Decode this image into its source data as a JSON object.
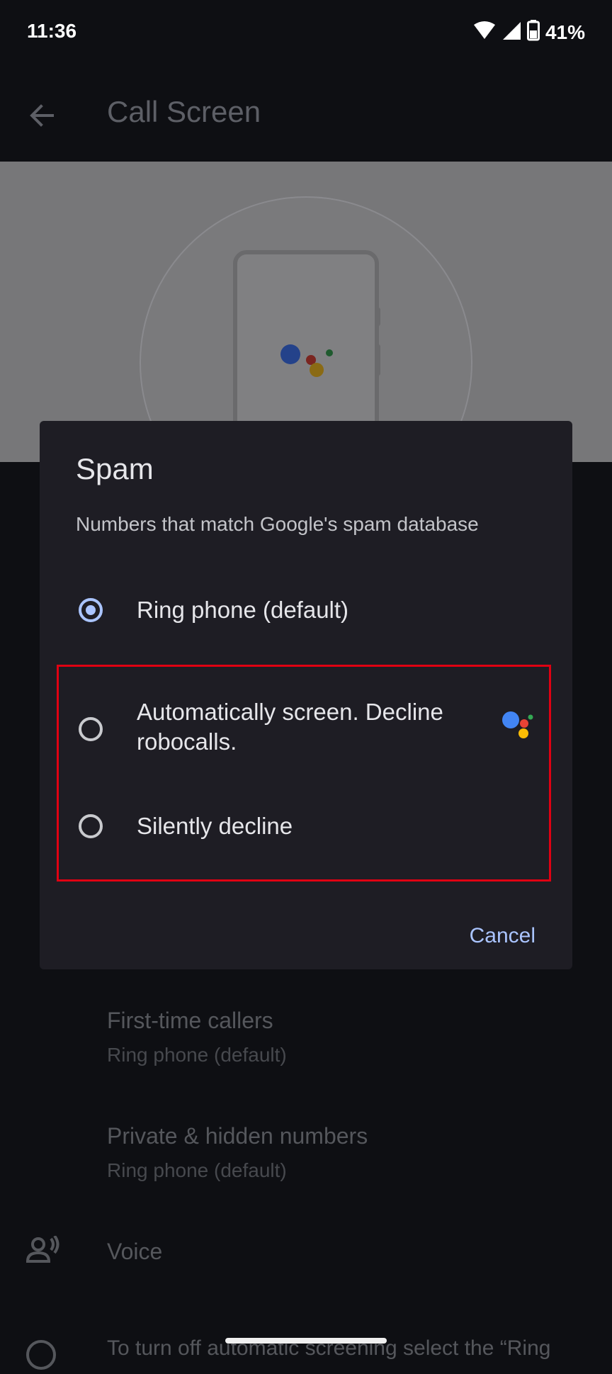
{
  "status_bar": {
    "time": "11:36",
    "battery": "41%"
  },
  "app_bar": {
    "title": "Call Screen"
  },
  "settings": {
    "first_time_callers": {
      "title": "First-time callers",
      "value": "Ring phone (default)"
    },
    "private_numbers": {
      "title": "Private & hidden numbers",
      "value": "Ring phone (default)"
    },
    "voice": {
      "label": "Voice"
    },
    "info_text": "To turn off automatic screening select the “Ring"
  },
  "dialog": {
    "title": "Spam",
    "subtitle": "Numbers that match Google's spam database",
    "options": [
      {
        "label": "Ring phone (default)",
        "selected": true
      },
      {
        "label_line1": "Automatically screen. Decline",
        "label_line2": "robocalls.",
        "selected": false
      },
      {
        "label": "Silently decline",
        "selected": false
      }
    ],
    "cancel_label": "Cancel"
  },
  "colors": {
    "accent": "#aac4ff",
    "highlight": "#e00012",
    "google_blue": "#4285f4",
    "google_red": "#ea4335",
    "google_yellow": "#fbbc05",
    "google_green": "#34a853"
  }
}
